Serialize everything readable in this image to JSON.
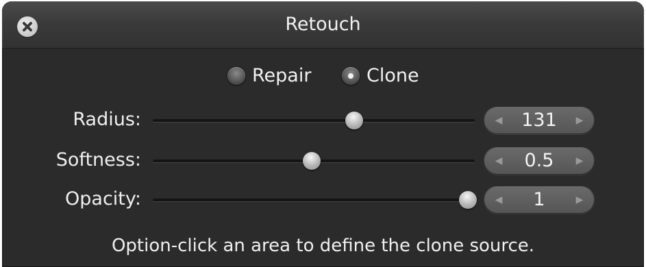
{
  "window": {
    "title": "Retouch",
    "close_icon": "close-icon"
  },
  "mode": {
    "options": [
      {
        "label": "Repair",
        "selected": false
      },
      {
        "label": "Clone",
        "selected": true
      }
    ]
  },
  "sliders": [
    {
      "label": "Radius:",
      "value": "131",
      "fraction": 0.64
    },
    {
      "label": "Softness:",
      "value": "0.5",
      "fraction": 0.505
    },
    {
      "label": "Opacity:",
      "value": "1",
      "fraction": 1.0
    }
  ],
  "stepper_icons": {
    "left": "triangle-left-icon",
    "right": "triangle-right-icon"
  },
  "hint": "Option-click an area to define the clone source.",
  "colors": {
    "panel_bg": "#2b2b2b",
    "text": "#f2f2f2"
  }
}
